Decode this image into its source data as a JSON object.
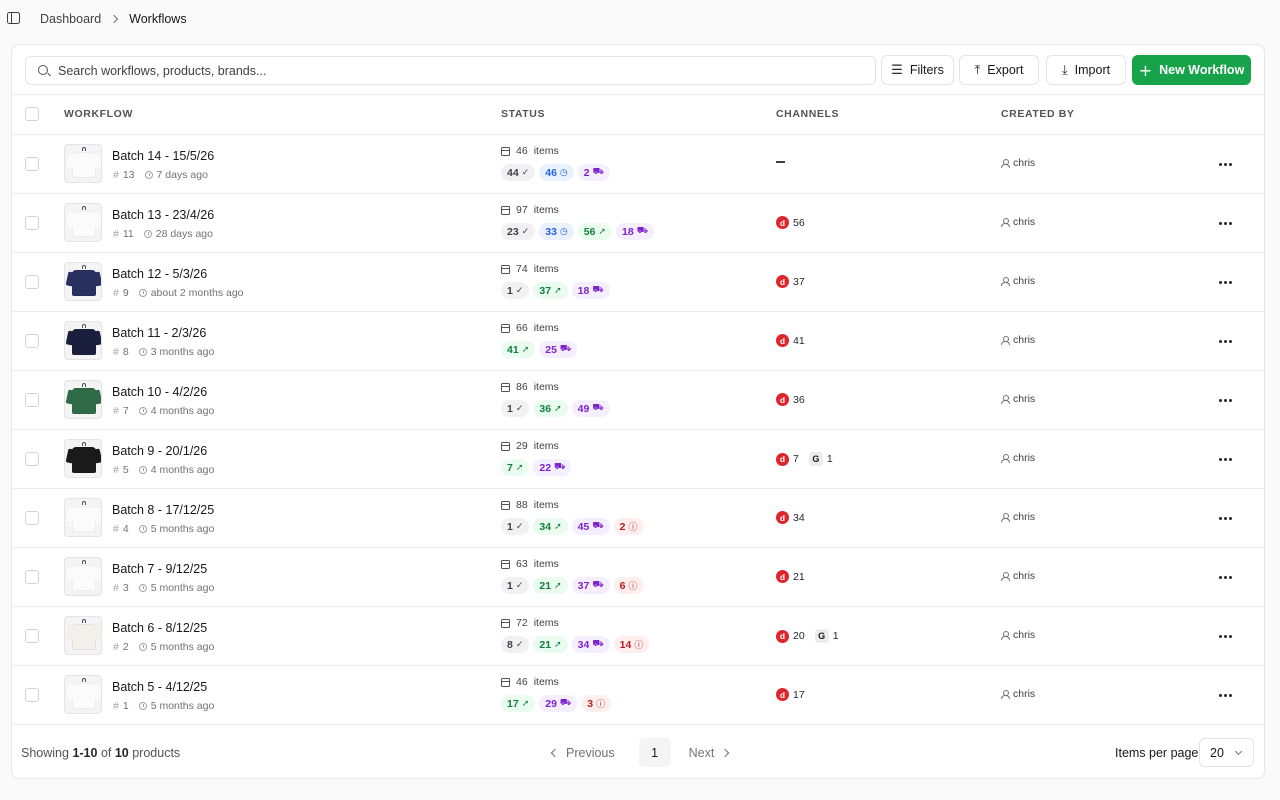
{
  "breadcrumb": {
    "parent": "Dashboard",
    "current": "Workflows"
  },
  "search": {
    "placeholder": "Search workflows, products, brands...",
    "value": ""
  },
  "toolbar": {
    "filters": "Filters",
    "export": "Export",
    "import": "Import",
    "new_workflow": "New Workflow"
  },
  "colors": {
    "accent": "#16a34a",
    "channel_red": "#e0242b"
  },
  "columns": {
    "workflow": "WORKFLOW",
    "status": "STATUS",
    "channels": "CHANNELS",
    "created_by": "CREATED BY"
  },
  "items_label": "items",
  "rows": [
    {
      "name": "Batch 14 - 15/5/26",
      "id": "13",
      "age": "7 days ago",
      "items": "46",
      "thumb": "white",
      "badges": [
        {
          "kind": "approved",
          "value": "44"
        },
        {
          "kind": "pending",
          "value": "46"
        },
        {
          "kind": "cart",
          "value": "2"
        }
      ],
      "channels": [],
      "creator": "chris"
    },
    {
      "name": "Batch 13 - 23/4/26",
      "id": "11",
      "age": "28 days ago",
      "items": "97",
      "thumb": "white",
      "badges": [
        {
          "kind": "approved",
          "value": "23"
        },
        {
          "kind": "pending",
          "value": "33"
        },
        {
          "kind": "published",
          "value": "56"
        },
        {
          "kind": "cart",
          "value": "18"
        }
      ],
      "channels": [
        {
          "type": "depop",
          "count": "56"
        }
      ],
      "creator": "chris"
    },
    {
      "name": "Batch 12 - 5/3/26",
      "id": "9",
      "age": "about 2 months ago",
      "items": "74",
      "thumb": "navy",
      "badges": [
        {
          "kind": "approved",
          "value": "1"
        },
        {
          "kind": "published",
          "value": "37"
        },
        {
          "kind": "cart",
          "value": "18"
        }
      ],
      "channels": [
        {
          "type": "depop",
          "count": "37"
        }
      ],
      "creator": "chris"
    },
    {
      "name": "Batch 11 - 2/3/26",
      "id": "8",
      "age": "3 months ago",
      "items": "66",
      "thumb": "darknavy",
      "badges": [
        {
          "kind": "published",
          "value": "41"
        },
        {
          "kind": "cart",
          "value": "25"
        }
      ],
      "channels": [
        {
          "type": "depop",
          "count": "41"
        }
      ],
      "creator": "chris"
    },
    {
      "name": "Batch 10 - 4/2/26",
      "id": "7",
      "age": "4 months ago",
      "items": "86",
      "thumb": "green",
      "badges": [
        {
          "kind": "approved",
          "value": "1"
        },
        {
          "kind": "published",
          "value": "36"
        },
        {
          "kind": "cart",
          "value": "49"
        }
      ],
      "channels": [
        {
          "type": "depop",
          "count": "36"
        }
      ],
      "creator": "chris"
    },
    {
      "name": "Batch 9 - 20/1/26",
      "id": "5",
      "age": "4 months ago",
      "items": "29",
      "thumb": "black",
      "badges": [
        {
          "kind": "published",
          "value": "7"
        },
        {
          "kind": "cart",
          "value": "22"
        }
      ],
      "channels": [
        {
          "type": "depop",
          "count": "7"
        },
        {
          "type": "g",
          "count": "1"
        }
      ],
      "creator": "chris"
    },
    {
      "name": "Batch 8 - 17/12/25",
      "id": "4",
      "age": "5 months ago",
      "items": "88",
      "thumb": "white",
      "badges": [
        {
          "kind": "approved",
          "value": "1"
        },
        {
          "kind": "published",
          "value": "34"
        },
        {
          "kind": "cart",
          "value": "45"
        },
        {
          "kind": "error",
          "value": "2"
        }
      ],
      "channels": [
        {
          "type": "depop",
          "count": "34"
        }
      ],
      "creator": "chris"
    },
    {
      "name": "Batch 7 - 9/12/25",
      "id": "3",
      "age": "5 months ago",
      "items": "63",
      "thumb": "white",
      "badges": [
        {
          "kind": "approved",
          "value": "1"
        },
        {
          "kind": "published",
          "value": "21"
        },
        {
          "kind": "cart",
          "value": "37"
        },
        {
          "kind": "error",
          "value": "6"
        }
      ],
      "channels": [
        {
          "type": "depop",
          "count": "21"
        }
      ],
      "creator": "chris"
    },
    {
      "name": "Batch 6 - 8/12/25",
      "id": "2",
      "age": "5 months ago",
      "items": "72",
      "thumb": "graphic",
      "badges": [
        {
          "kind": "approved",
          "value": "8"
        },
        {
          "kind": "published",
          "value": "21"
        },
        {
          "kind": "cart",
          "value": "34"
        },
        {
          "kind": "error",
          "value": "14"
        }
      ],
      "channels": [
        {
          "type": "depop",
          "count": "20"
        },
        {
          "type": "g",
          "count": "1"
        }
      ],
      "creator": "chris"
    },
    {
      "name": "Batch 5 - 4/12/25",
      "id": "1",
      "age": "5 months ago",
      "items": "46",
      "thumb": "white",
      "badges": [
        {
          "kind": "published",
          "value": "17"
        },
        {
          "kind": "cart",
          "value": "29"
        },
        {
          "kind": "error",
          "value": "3"
        }
      ],
      "channels": [
        {
          "type": "depop",
          "count": "17"
        }
      ],
      "creator": "chris"
    }
  ],
  "footer": {
    "showing_prefix": "Showing ",
    "range": "1-10",
    "of": " of ",
    "total": "10",
    "suffix": " products",
    "previous": "Previous",
    "page": "1",
    "next": "Next",
    "items_per_page_label": "Items per page",
    "items_per_page": "20"
  }
}
